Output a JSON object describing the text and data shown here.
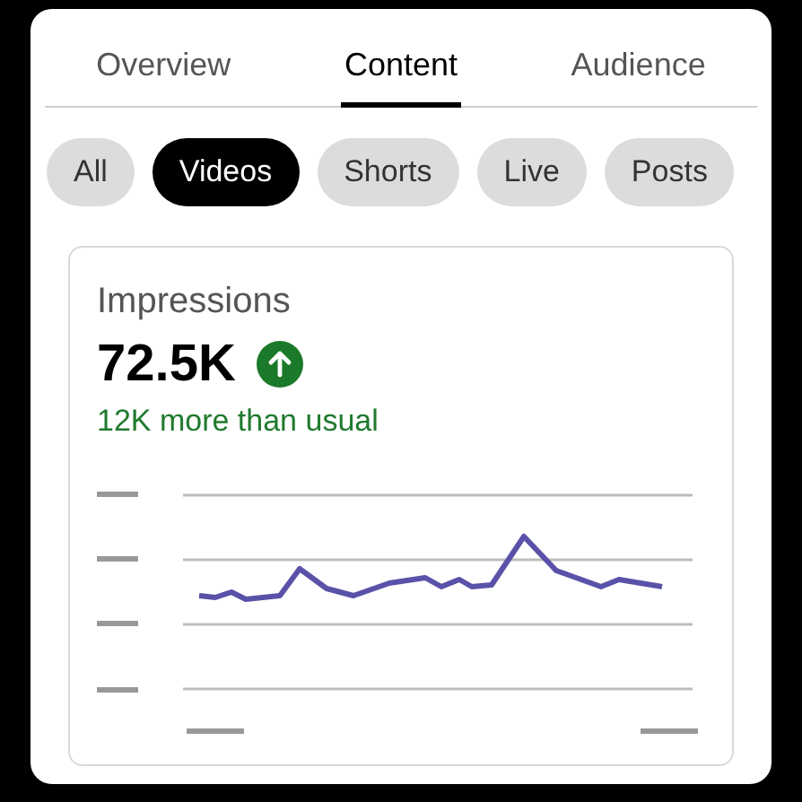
{
  "tabs": [
    {
      "label": "Overview",
      "selected": false
    },
    {
      "label": "Content",
      "selected": true
    },
    {
      "label": "Audience",
      "selected": false
    }
  ],
  "filters": [
    {
      "label": "All",
      "selected": false
    },
    {
      "label": "Videos",
      "selected": true
    },
    {
      "label": "Shorts",
      "selected": false
    },
    {
      "label": "Live",
      "selected": false
    },
    {
      "label": "Posts",
      "selected": false
    }
  ],
  "metric_card": {
    "title": "Impressions",
    "value": "72.5K",
    "increased": true,
    "comparison": "12K more than usual"
  }
}
